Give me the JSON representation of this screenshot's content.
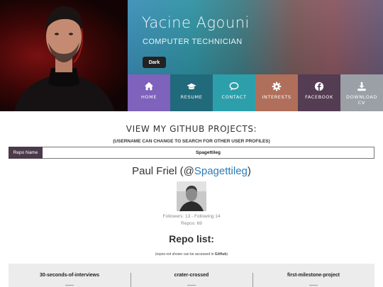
{
  "profile": {
    "name": "Yacine Agouni",
    "role": "COMPUTER TECHNICIAN",
    "theme_button": "Dark"
  },
  "nav": {
    "items": [
      {
        "label": "HOME",
        "icon": "home-icon",
        "color": "#7e62bb"
      },
      {
        "label": "RESUME",
        "icon": "graduation-cap-icon",
        "color": "#216a7b"
      },
      {
        "label": "CONTACT",
        "icon": "chat-bubble-icon",
        "color": "#2d9fab"
      },
      {
        "label": "INTERESTS",
        "icon": "gear-icon",
        "color": "#b06f5a"
      },
      {
        "label": "FACEBOOK",
        "icon": "facebook-icon",
        "color": "#543c52"
      },
      {
        "label": "DOWNLOAD",
        "label2": "CV",
        "icon": "download-icon",
        "color": "#9b9fa6"
      }
    ]
  },
  "github": {
    "title": "VIEW MY GITHUB PROJECTS:",
    "subtitle": "(USERNAME CAN CHANGE TO SEARCH FOR OTHER USER PROFILES)",
    "repo_label": "Repo Name",
    "repo_value": "Spagettileg",
    "user_name": "Paul Friel (@",
    "user_handle": "Spagettileg",
    "user_close": ")",
    "followers_line": "Followers: 13 - Following 14",
    "repos_line": "Repos: 69",
    "repo_list_title": "Repo list:",
    "repo_note_prefix": "(repos not shown can be accessed in ",
    "repo_note_link": "GitHub",
    "repo_note_suffix": ")",
    "repos": [
      "30-seconds-of-interviews",
      "crater-crossed",
      "first-milestone-project"
    ]
  },
  "colors": {
    "accent_link": "#2b7bb9",
    "label_bg": "#4a3a4a"
  }
}
